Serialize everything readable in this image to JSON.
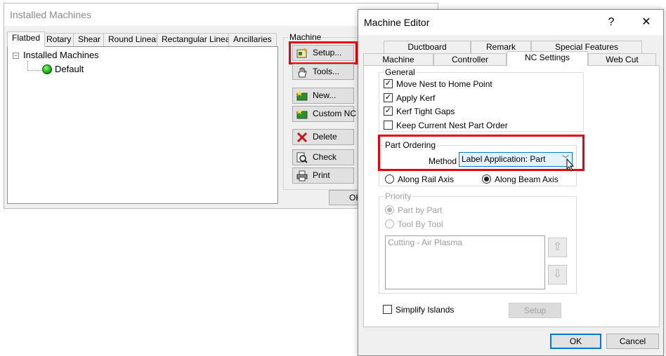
{
  "installed_machines": {
    "title": "Installed Machines",
    "tabs": [
      "Flatbed",
      "Rotary",
      "Shear",
      "Round Linear",
      "Rectangular Linear",
      "Ancillaries"
    ],
    "tree_root": "Installed Machines",
    "tree_child": "Default",
    "machine_group_label": "Machine",
    "buttons": {
      "setup": "Setup...",
      "tools": "Tools...",
      "new": "New...",
      "custom_nc": "Custom NC",
      "delete": "Delete",
      "check": "Check",
      "print": "Print",
      "ok_partial": "OK"
    }
  },
  "machine_editor": {
    "title": "Machine Editor",
    "help_glyph": "?",
    "close_glyph": "✕",
    "tabs_row1": [
      "Ductboard",
      "Remark",
      "Special Features"
    ],
    "tabs_row2": [
      "Machine",
      "Controller",
      "NC Settings",
      "Web Cut"
    ],
    "general": {
      "legend": "General",
      "options": [
        {
          "label": "Move Nest to Home Point",
          "checked": true
        },
        {
          "label": "Apply Kerf",
          "checked": true
        },
        {
          "label": "Kerf Tight Gaps",
          "checked": true
        },
        {
          "label": "Keep Current Nest Part Order",
          "checked": false
        }
      ]
    },
    "part_ordering": {
      "legend": "Part Ordering",
      "method_label": "Method",
      "method_value": "Label Application: Part",
      "along_rail": "Along Rail Axis",
      "along_beam": "Along Beam Axis",
      "selected_axis": "Along Beam Axis"
    },
    "priority": {
      "legend": "Priority",
      "part_by_part": "Part by Part",
      "tool_by_tool": "Tool By Tool",
      "list_items": [
        "Cutting - Air Plasma"
      ]
    },
    "simplify_islands": "Simplify Islands",
    "simplify_checked": false,
    "setup_button": "Setup",
    "ok_button": "OK",
    "cancel_button": "Cancel"
  },
  "colors": {
    "highlight_red": "#e8000b",
    "select_blue": "#0078d7",
    "window_bg": "#f0f0f0"
  }
}
